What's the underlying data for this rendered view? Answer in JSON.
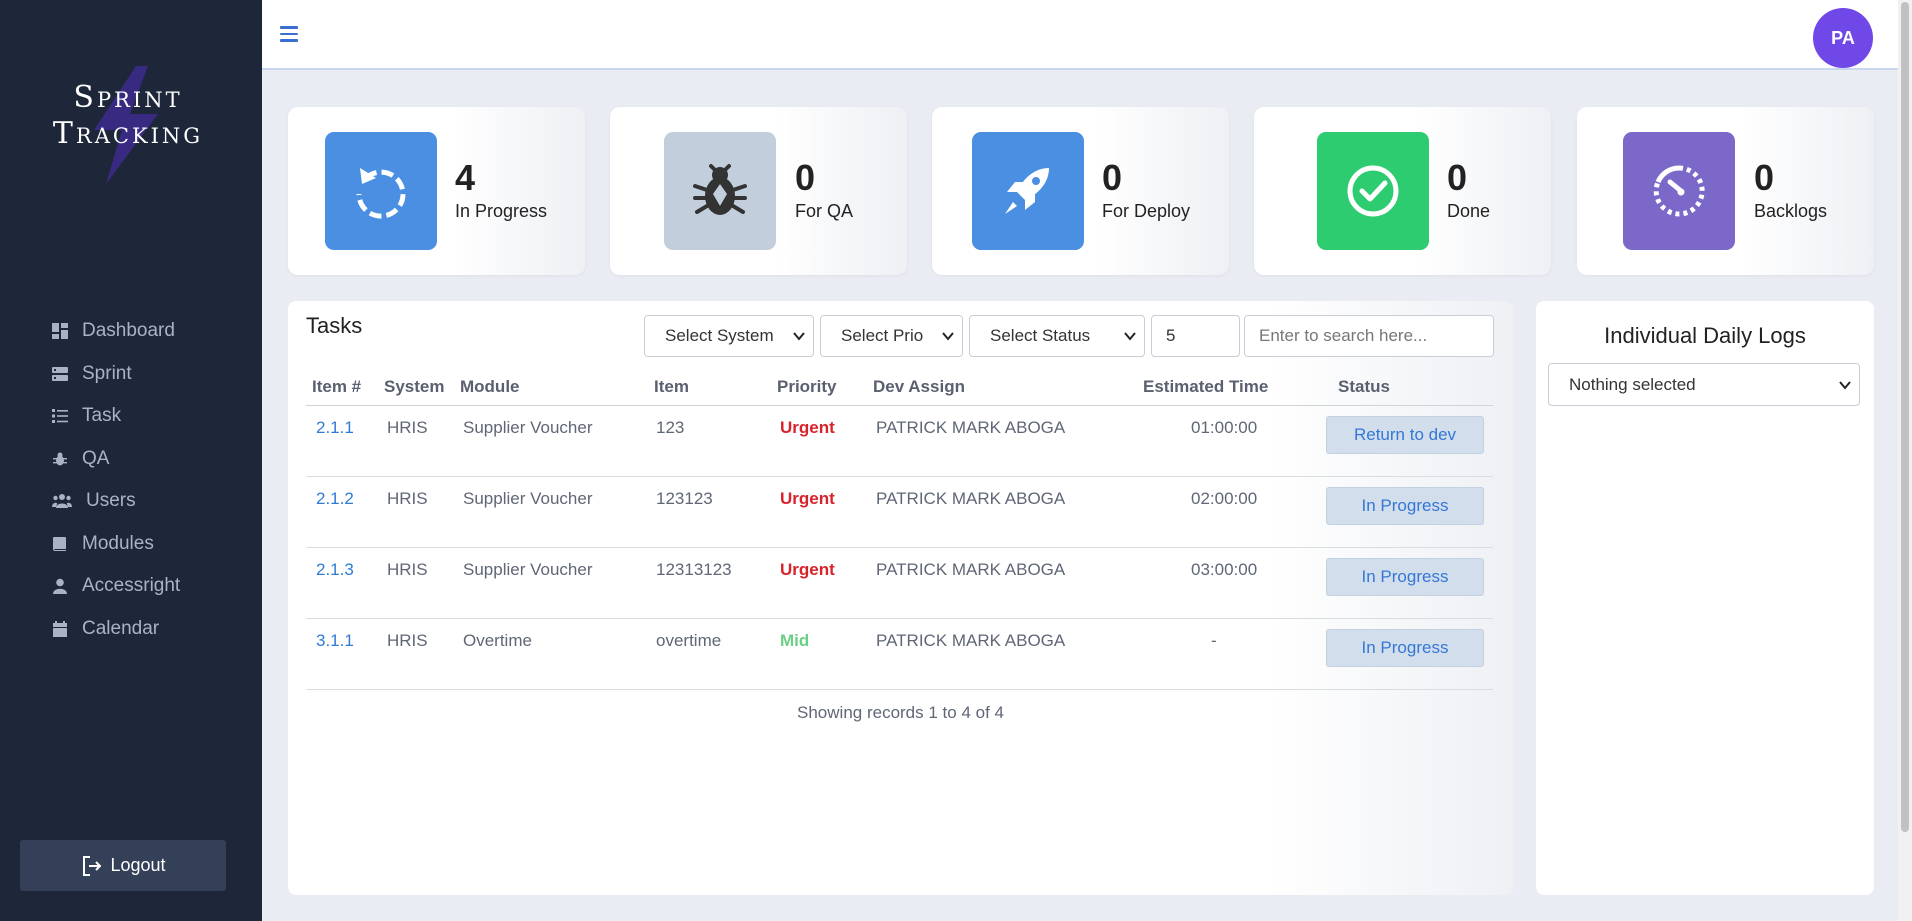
{
  "app": {
    "logo_line1": "Sprint",
    "logo_line2": "Tracking",
    "avatar_initials": "PA",
    "accent_color": "#7048e8"
  },
  "sidebar": {
    "items": [
      {
        "label": "Dashboard",
        "icon": "dashboard-icon"
      },
      {
        "label": "Sprint",
        "icon": "sprint-icon"
      },
      {
        "label": "Task",
        "icon": "task-icon"
      },
      {
        "label": "QA",
        "icon": "bug-icon"
      },
      {
        "label": "Users",
        "icon": "users-icon"
      },
      {
        "label": "Modules",
        "icon": "book-icon"
      },
      {
        "label": "Accessright",
        "icon": "user-icon"
      },
      {
        "label": "Calendar",
        "icon": "calendar-icon"
      }
    ],
    "logout_label": "Logout"
  },
  "stats": [
    {
      "value": "4",
      "label": "In Progress",
      "color": "#4a8fe2",
      "icon": "refresh-icon"
    },
    {
      "value": "0",
      "label": "For QA",
      "color": "#c3cedc",
      "icon": "bug-icon"
    },
    {
      "value": "0",
      "label": "For Deploy",
      "color": "#4a8fe2",
      "icon": "rocket-icon"
    },
    {
      "value": "0",
      "label": "Done",
      "color": "#2ecc71",
      "icon": "check-circle-icon"
    },
    {
      "value": "0",
      "label": "Backlogs",
      "color": "#7b68c8",
      "icon": "timer-icon"
    }
  ],
  "tasks": {
    "title": "Tasks",
    "filters": {
      "system": "Select System",
      "prio": "Select Prio",
      "status": "Select Status",
      "page_size": "5",
      "search_placeholder": "Enter to search here..."
    },
    "columns": [
      "Item #",
      "System",
      "Module",
      "Item",
      "Priority",
      "Dev Assign",
      "Estimated Time",
      "Status"
    ],
    "rows": [
      {
        "item_no": "2.1.1",
        "system": "HRIS",
        "module": "Supplier Voucher",
        "item": "123",
        "priority": "Urgent",
        "priority_color": "#d9232b",
        "dev": "PATRICK MARK ABOGA",
        "est": "01:00:00",
        "status": "Return to dev"
      },
      {
        "item_no": "2.1.2",
        "system": "HRIS",
        "module": "Supplier Voucher",
        "item": "123123",
        "priority": "Urgent",
        "priority_color": "#d9232b",
        "dev": "PATRICK MARK ABOGA",
        "est": "02:00:00",
        "status": "In Progress"
      },
      {
        "item_no": "2.1.3",
        "system": "HRIS",
        "module": "Supplier Voucher",
        "item": "12313123",
        "priority": "Urgent",
        "priority_color": "#d9232b",
        "dev": "PATRICK MARK ABOGA",
        "est": "03:00:00",
        "status": "In Progress"
      },
      {
        "item_no": "3.1.1",
        "system": "HRIS",
        "module": "Overtime",
        "item": "overtime",
        "priority": "Mid",
        "priority_color": "#6bcf86",
        "dev": "PATRICK MARK ABOGA",
        "est": "-",
        "status": "In Progress"
      }
    ],
    "records_text": "Showing records 1 to 4 of 4"
  },
  "logs": {
    "title": "Individual Daily Logs",
    "select_value": "Nothing selected"
  }
}
